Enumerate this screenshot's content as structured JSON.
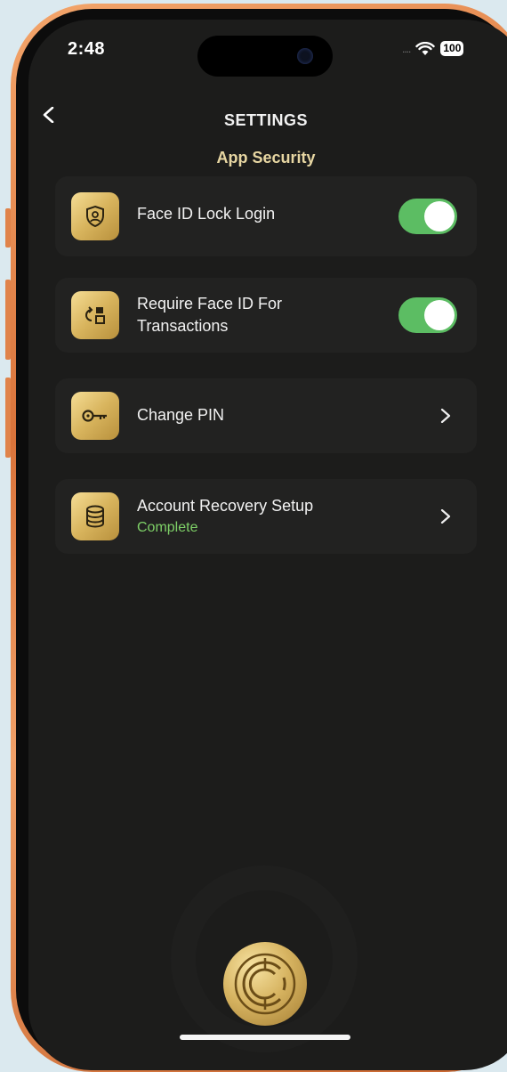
{
  "status_bar": {
    "time": "2:48",
    "signal": "....",
    "battery": "100"
  },
  "header": {
    "title": "SETTINGS",
    "subtitle": "App Security"
  },
  "settings": [
    {
      "label": "Face ID Lock Login",
      "icon": "shield-user-icon",
      "control": "toggle",
      "enabled": true
    },
    {
      "label": "Require Face ID For Transactions",
      "label_line1": "Require Face ID For",
      "label_line2": "Transactions",
      "icon": "swap-icon",
      "control": "toggle",
      "enabled": true
    },
    {
      "label": "Change PIN",
      "icon": "key-icon",
      "control": "chevron"
    },
    {
      "label": "Account Recovery Setup",
      "sublabel": "Complete",
      "icon": "database-icon",
      "control": "chevron"
    }
  ],
  "colors": {
    "accent_gold": "#d8b45d",
    "toggle_on": "#5cbd63",
    "complete_green": "#7ed067",
    "subtitle_gold": "#e7d6a2"
  }
}
